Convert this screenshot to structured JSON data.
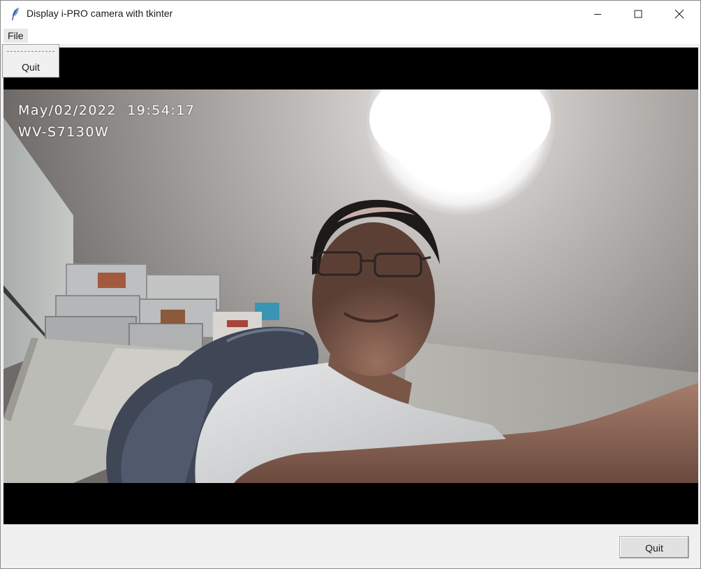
{
  "window": {
    "title": "Display i-PRO camera with tkinter"
  },
  "menubar": {
    "file_label": "File"
  },
  "file_menu": {
    "items": [
      "Quit"
    ]
  },
  "camera": {
    "datetime": "May/02/2022  19:54:17",
    "model": "WV-S7130W"
  },
  "footer": {
    "quit_label": "Quit"
  },
  "icons": {
    "app": "feather-icon",
    "minimize": "minimize-icon",
    "maximize": "maximize-icon",
    "close": "close-icon"
  }
}
